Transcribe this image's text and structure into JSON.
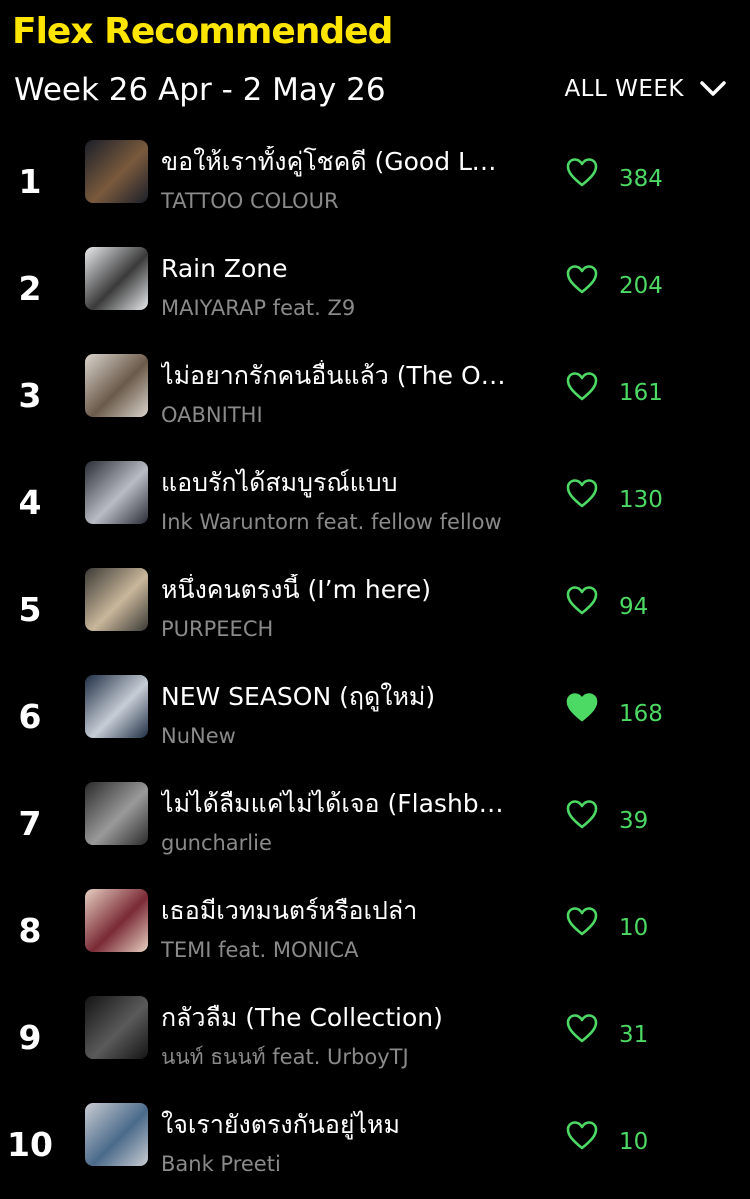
{
  "header": {
    "title": "Flex Recommended",
    "week_label": "Week 26 Apr - 2 May 26",
    "filter_label": "ALL WEEK",
    "filter_icon": "chevron-down-icon"
  },
  "colors": {
    "title": "#ffe500",
    "accent_green": "#4cd964",
    "artist_gray": "#8a8a8a",
    "background": "#000000"
  },
  "songs": [
    {
      "rank": "1",
      "title": "ขอให้เราทั้งคู่โชคดี (Good Luck)",
      "artist": "TATTOO COLOUR",
      "likes": "384",
      "liked": false,
      "cover": [
        "#1b1f2a",
        "#7a5a3c"
      ]
    },
    {
      "rank": "2",
      "title": "Rain Zone",
      "artist": "MAIYARAP feat. Z9",
      "likes": "204",
      "liked": false,
      "cover": [
        "#e8eaec",
        "#3a3a3a"
      ]
    },
    {
      "rank": "3",
      "title": "ไม่อยากรักคนอื่นแล้ว (The One)",
      "artist": "OABNITHI",
      "likes": "161",
      "liked": false,
      "cover": [
        "#d9d4cc",
        "#6b5a4a"
      ]
    },
    {
      "rank": "4",
      "title": "แอบรักได้สมบูรณ์แบบ",
      "artist": "Ink Waruntorn feat. fellow fellow",
      "likes": "130",
      "liked": false,
      "cover": [
        "#2a2d36",
        "#b9bcc4"
      ]
    },
    {
      "rank": "5",
      "title": "หนึ่งคนตรงนี้ (I’m here)",
      "artist": "PURPEECH",
      "likes": "94",
      "liked": false,
      "cover": [
        "#3b3a36",
        "#c9b79a"
      ]
    },
    {
      "rank": "6",
      "title": "NEW SEASON (ฤดูใหม่)",
      "artist": "NuNew",
      "likes": "168",
      "liked": true,
      "cover": [
        "#1f2f45",
        "#c7cdd6"
      ]
    },
    {
      "rank": "7",
      "title": "ไม่ได้ลืมแค่ไม่ได้เจอ (Flashback)",
      "artist": "guncharlie",
      "likes": "39",
      "liked": false,
      "cover": [
        "#2b2b2b",
        "#9a9a9a"
      ]
    },
    {
      "rank": "8",
      "title": "เธอมีเวทมนตร์หรือเปล่า",
      "artist": "TEMI feat. MONICA",
      "likes": "10",
      "liked": false,
      "cover": [
        "#e6cfc2",
        "#7a2a35"
      ]
    },
    {
      "rank": "9",
      "title": "กลัวลืม (The Collection)",
      "artist": "นนท์ ธนนท์ feat. UrboyTJ",
      "likes": "31",
      "liked": false,
      "cover": [
        "#141414",
        "#5a5a5a"
      ]
    },
    {
      "rank": "10",
      "title": "ใจเรายังตรงกันอยู่ไหม",
      "artist": "Bank Preeti",
      "likes": "10",
      "liked": false,
      "cover": [
        "#c9ccd2",
        "#4a6a8a"
      ]
    }
  ]
}
